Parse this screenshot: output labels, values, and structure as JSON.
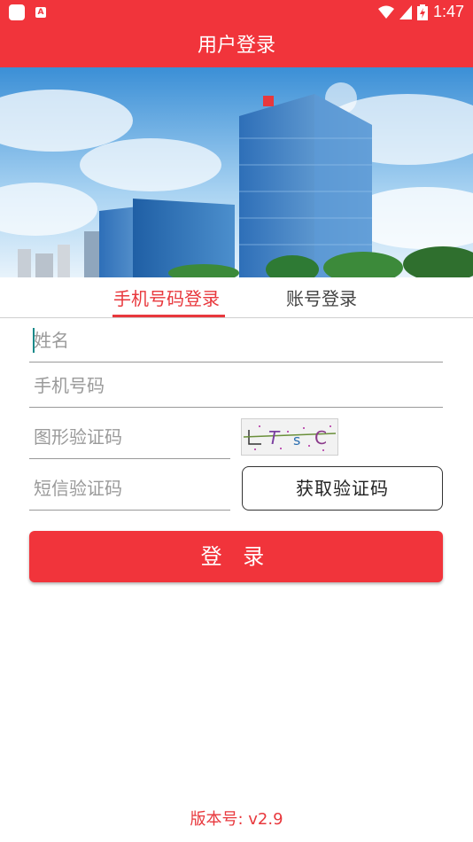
{
  "status": {
    "time": "1:47",
    "a_icon_letter": "A"
  },
  "header": {
    "title": "用户登录"
  },
  "tabs": [
    {
      "label": "手机号码登录",
      "active": true
    },
    {
      "label": "账号登录",
      "active": false
    }
  ],
  "form": {
    "name": {
      "placeholder": "姓名"
    },
    "phone": {
      "placeholder": "手机号码"
    },
    "captcha": {
      "placeholder": "图形验证码",
      "image_text": "LTSC"
    },
    "sms": {
      "placeholder": "短信验证码",
      "button_label": "获取验证码"
    }
  },
  "login_button": "登 录",
  "footer": {
    "version_label": "版本号: v2.9"
  },
  "colors": {
    "brand": "#f1343b",
    "tab_active": "#e8383d"
  }
}
